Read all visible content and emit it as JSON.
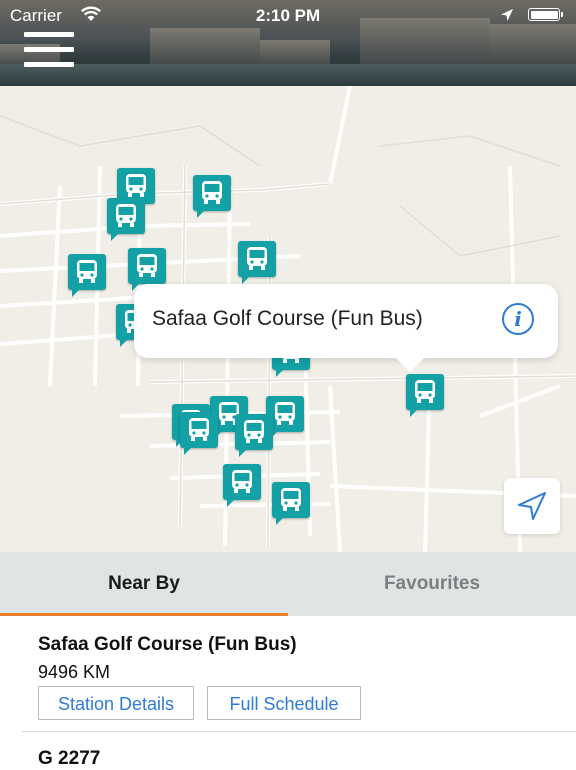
{
  "status_bar": {
    "carrier": "Carrier",
    "time": "2:10 PM"
  },
  "header": {
    "menu_icon": "hamburger-menu-icon"
  },
  "map": {
    "pin_icon": "bus-icon",
    "callout": {
      "title": "Safaa Golf Course (Fun Bus)",
      "info_icon": "info-icon"
    },
    "locate_icon": "location-arrow-icon"
  },
  "tabs": [
    {
      "label": "Near By",
      "active": true
    },
    {
      "label": "Favourites",
      "active": false
    }
  ],
  "stations": [
    {
      "name": "Safaa Golf Course (Fun Bus)",
      "distance": "9496  KM",
      "buttons": {
        "details": "Station Details",
        "schedule": "Full Schedule"
      }
    },
    {
      "name": "G 2277"
    }
  ],
  "colors": {
    "pin": "#13a1a6",
    "tab_accent": "#ef7d2a",
    "link_blue": "#2f7bd6",
    "tab_bar": "#dfe5e5",
    "map_bg": "#f1eee7"
  }
}
